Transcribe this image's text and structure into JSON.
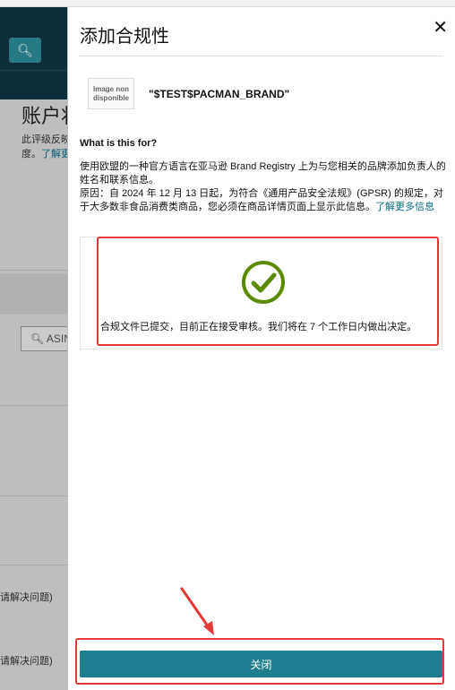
{
  "background": {
    "page_title_partial": "账户状",
    "desc_partial": "此评级反映",
    "desc_partial2": "度。",
    "desc_link_partial": "了解更",
    "search_label_partial": "ASIN",
    "row1_partial": "请解决问题)",
    "row2_partial": "请解决问题)"
  },
  "modal": {
    "title": "添加合规性",
    "product": {
      "thumb_line1": "Image non",
      "thumb_line2": "disponible",
      "brand": "\"$TEST$PACMAN_BRAND\""
    },
    "what_heading": "What is this for?",
    "description": "使用欧盟的一种官方语言在亚马逊 Brand Registry 上为与您相关的品牌添加负责人的姓名和联系信息。",
    "reason": "原因：自 2024 年 12 月 13 日起，为符合《通用产品安全法规》(GPSR) 的规定，对于大多数非食品消费类商品，您必须在商品详情页面上显示此信息。",
    "learn_more": "了解更多信息",
    "status_message": "合规文件已提交，目前正在接受审核。我们将在 7 个工作日内做出决定。",
    "close_button": "关闭"
  },
  "colors": {
    "accent": "#1f7f90",
    "success": "#5a8a00",
    "annotation": "#e53935"
  }
}
